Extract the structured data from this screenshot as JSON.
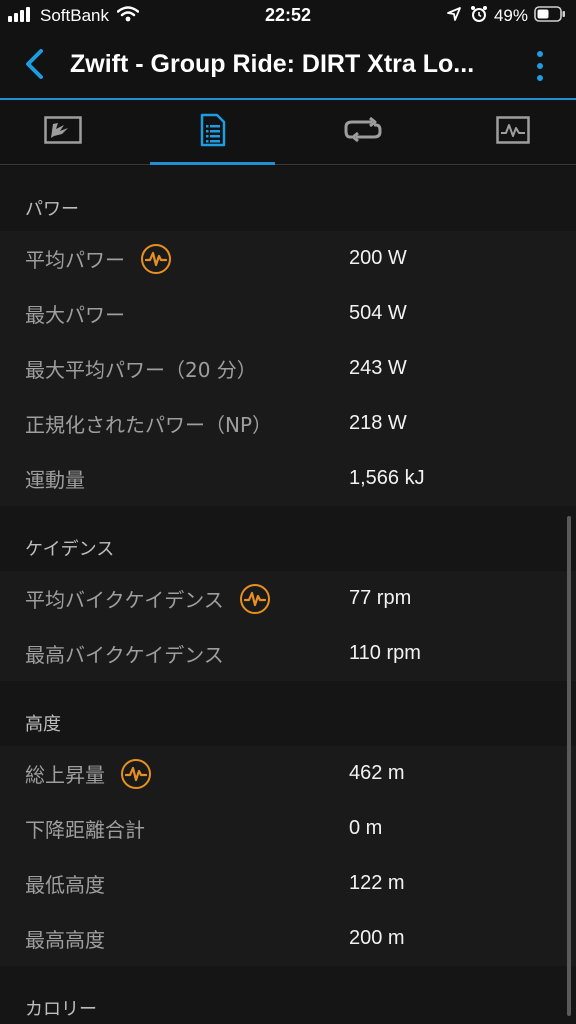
{
  "status_bar": {
    "carrier": "SoftBank",
    "time": "22:52",
    "battery_percent": "49%"
  },
  "app_bar": {
    "title": "Zwift - Group Ride: DIRT Xtra Lo...",
    "back_icon": "chevron-left-icon",
    "menu_icon": "more-vertical-icon",
    "accent_color": "#1f8fd6"
  },
  "tabs": [
    {
      "icon": "map-icon",
      "active": false
    },
    {
      "icon": "stats-list-icon",
      "active": true
    },
    {
      "icon": "laps-icon",
      "active": false
    },
    {
      "icon": "chart-icon",
      "active": false
    }
  ],
  "sections": {
    "power": {
      "title": "パワー",
      "rows": [
        {
          "label": "平均パワー",
          "value": "200 W",
          "badge": true
        },
        {
          "label": "最大パワー",
          "value": "504 W"
        },
        {
          "label": "最大平均パワー（20 分）",
          "value": "243 W"
        },
        {
          "label": "正規化されたパワー（NP）",
          "value": "218 W"
        },
        {
          "label": "運動量",
          "value": "1,566 kJ"
        }
      ]
    },
    "cadence": {
      "title": "ケイデンス",
      "rows": [
        {
          "label": "平均バイクケイデンス",
          "value": "77 rpm",
          "badge": true
        },
        {
          "label": "最高バイクケイデンス",
          "value": "110 rpm"
        }
      ]
    },
    "elevation": {
      "title": "高度",
      "rows": [
        {
          "label": "総上昇量",
          "value": "462 m",
          "badge": true
        },
        {
          "label": "下降距離合計",
          "value": "0 m"
        },
        {
          "label": "最低高度",
          "value": "122 m"
        },
        {
          "label": "最高高度",
          "value": "200 m"
        }
      ]
    },
    "calories": {
      "title": "カロリー"
    }
  },
  "badge_icon": "heart-rate-pulse-icon",
  "badge_color": "#e8901f"
}
